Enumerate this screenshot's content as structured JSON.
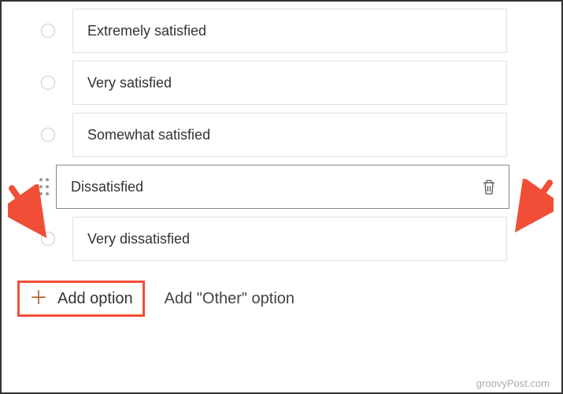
{
  "options": [
    {
      "label": "Extremely satisfied",
      "focused": false
    },
    {
      "label": "Very satisfied",
      "focused": false
    },
    {
      "label": "Somewhat satisfied",
      "focused": false
    },
    {
      "label": "Dissatisfied",
      "focused": true
    },
    {
      "label": "Very dissatisfied",
      "focused": false
    }
  ],
  "controls": {
    "add_option_label": "Add option",
    "add_other_label": "Add \"Other\" option"
  },
  "watermark": "groovyPost.com",
  "annotation": {
    "arrow_color": "#f04e37",
    "highlight_color": "#f04e37"
  }
}
